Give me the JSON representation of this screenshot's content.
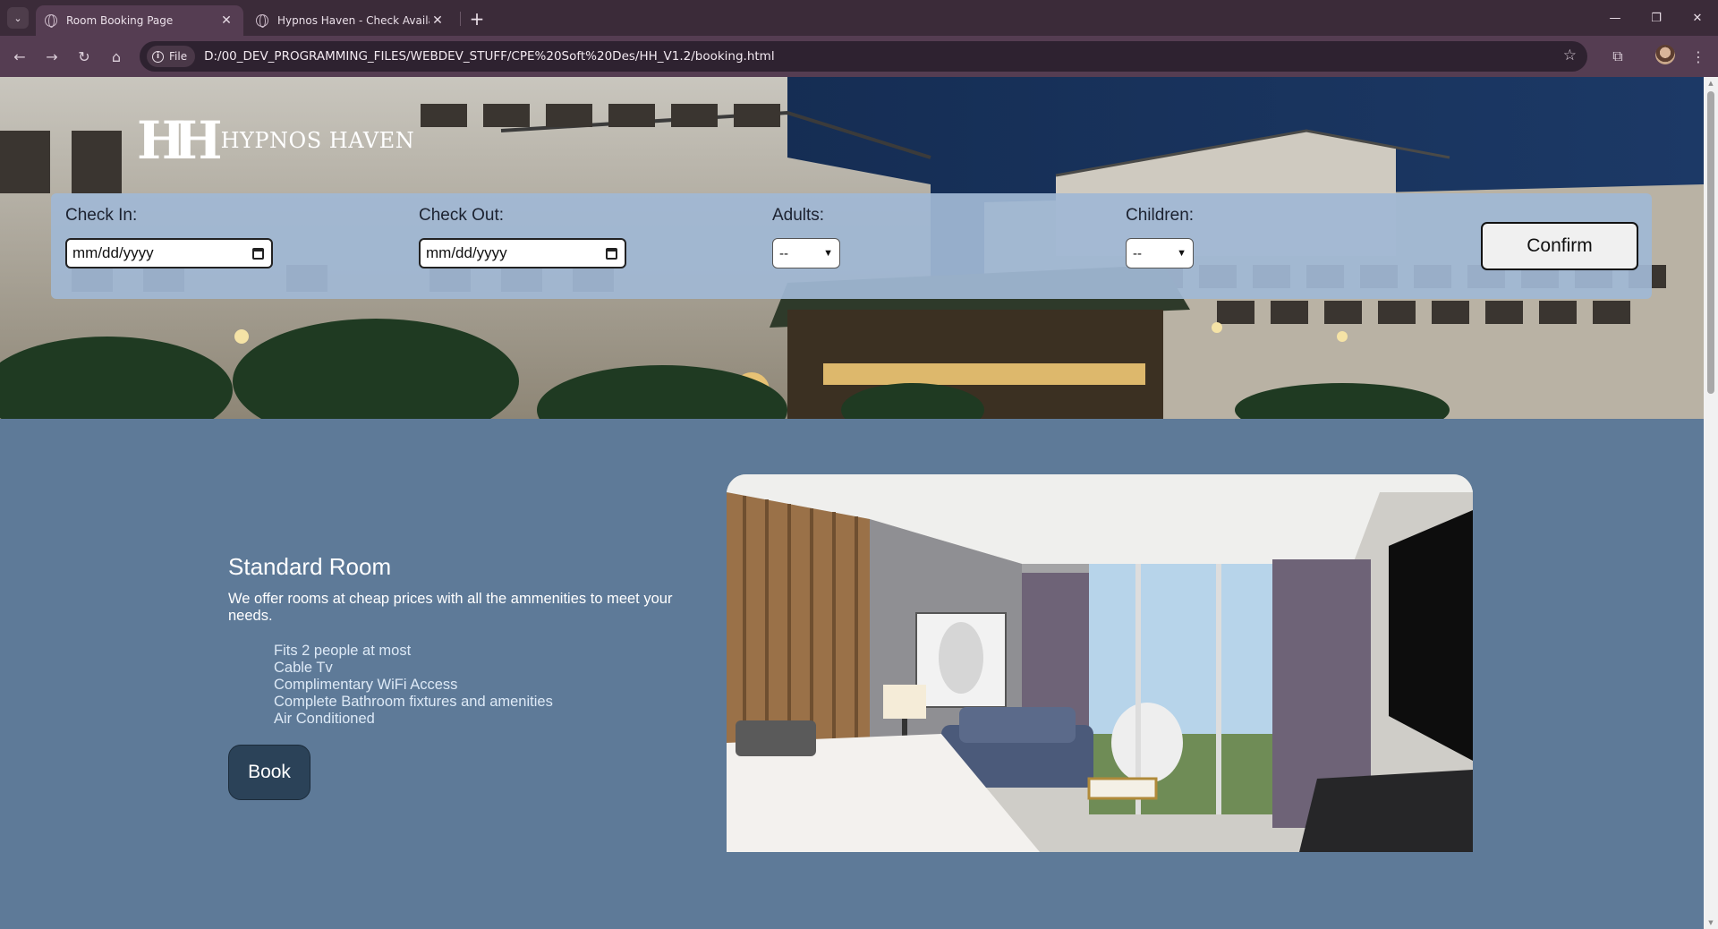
{
  "browser": {
    "tabs": [
      {
        "title": "Room Booking Page",
        "active": true
      },
      {
        "title": "Hypnos Haven - Check Availabi",
        "active": false
      }
    ],
    "url_chip": "File",
    "url": "D:/00_DEV_PROGRAMMING_FILES/WEBDEV_STUFF/CPE%20Soft%20Des/HH_V1.2/booking.html"
  },
  "brand": {
    "logo_mark": "HH",
    "name": "HYPNOS HAVEN"
  },
  "booking": {
    "check_in_label": "Check In:",
    "check_in_value": "mm/dd/yyyy",
    "check_out_label": "Check Out:",
    "check_out_value": "mm/dd/yyyy",
    "adults_label": "Adults:",
    "adults_value": "--",
    "children_label": "Children:",
    "children_value": "--",
    "confirm_label": "Confirm"
  },
  "room": {
    "title": "Standard Room",
    "description": "We offer rooms at cheap prices with all the ammenities to meet your needs.",
    "amenities": [
      "Fits 2 people at most",
      "Cable Tv",
      "Complimentary WiFi Access",
      "Complete Bathroom fixtures and amenities",
      "Air Conditioned"
    ],
    "book_label": "Book"
  },
  "colors": {
    "page_background": "#5e7a98",
    "booking_bar": "#a0b8d4",
    "book_button": "#2b4258",
    "chrome": "#3b2b39"
  }
}
